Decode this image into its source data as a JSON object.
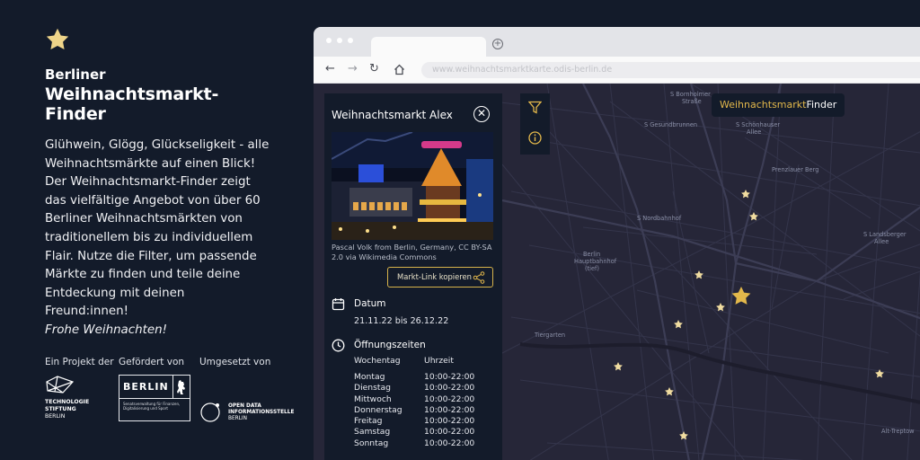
{
  "left": {
    "brand_small": "Berliner",
    "brand_big": "Weihnachtsmarkt-Finder",
    "intro": "Glühwein, Glögg, Glückseligkeit - alle Weihnachtsmärkte auf einen Blick! Der Weihnachtsmarkt-Finder zeigt das vielfältige Angebot von über 60 Berliner Weihnachtsmärkten von traditionellem bis zu individuellem Flair. Nutze die Filter, um passende Märkte zu finden und teile deine Entdeckung mit deinen Freund:innen!",
    "greeting": "Frohe Weihnachten!",
    "partners": {
      "label_project": "Ein Projekt der",
      "label_funded": "Gefördert von",
      "label_implemented": "Umgesetzt von",
      "tsb_line1": "TECHNOLOGIE",
      "tsb_line2": "STIFTUNG",
      "tsb_line3": "BERLIN",
      "berlin_word": "BERLIN",
      "berlin_sub": "Senatsverwaltung für Finanzen, Digitalisierung und Sport",
      "odis_line1": "OPEN DATA",
      "odis_line2": "INFORMATIONSSTELLE",
      "odis_line3": "BERLIN"
    }
  },
  "browser": {
    "url": "www.weihnachtsmarktkarte.odis-berlin.de"
  },
  "panel": {
    "title": "Weihnachtsmarkt Alex",
    "credit": "Pascal Volk from Berlin, Germany, CC BY-SA 2.0 via Wikimedia Commons",
    "share_label": "Markt-Link kopieren",
    "date_title": "Datum",
    "date_value": "21.11.22 bis 26.12.22",
    "hours_title": "Öffnungszeiten",
    "hours_col_day": "Wochentag",
    "hours_col_time": "Uhrzeit",
    "hours": [
      {
        "day": "Montag",
        "time": "10:00-22:00"
      },
      {
        "day": "Dienstag",
        "time": "10:00-22:00"
      },
      {
        "day": "Mittwoch",
        "time": "10:00-22:00"
      },
      {
        "day": "Donnerstag",
        "time": "10:00-22:00"
      },
      {
        "day": "Freitag",
        "time": "10:00-22:00"
      },
      {
        "day": "Samstag",
        "time": "10:00-22:00"
      },
      {
        "day": "Sonntag",
        "time": "10:00-22:00"
      }
    ]
  },
  "map": {
    "badge_gold": "Weihnachtsmarkt",
    "badge_white": "Finder",
    "places": {
      "bornholmer": "S Bornholmer",
      "bornholmer2": "Straße",
      "gesundbrunnen": "S Gesundbrunnen",
      "schoenhauser": "S Schönhauser",
      "schoenhauser2": "Allee",
      "prenzlauer": "Prenzlauer Berg",
      "nordbahnhof": "S Nordbahnhof",
      "landsberger": "S Landsberger",
      "landsberger2": "Allee",
      "hbf": "Berlin",
      "hbf2": "Hauptbahnhof",
      "hbf3": "(tief)",
      "tiergarten": "Tiergarten",
      "treptow": "Alt-Treptow"
    }
  },
  "colors": {
    "background": "#131b2a",
    "accent_gold": "#e3b84b",
    "map": "#262638"
  }
}
